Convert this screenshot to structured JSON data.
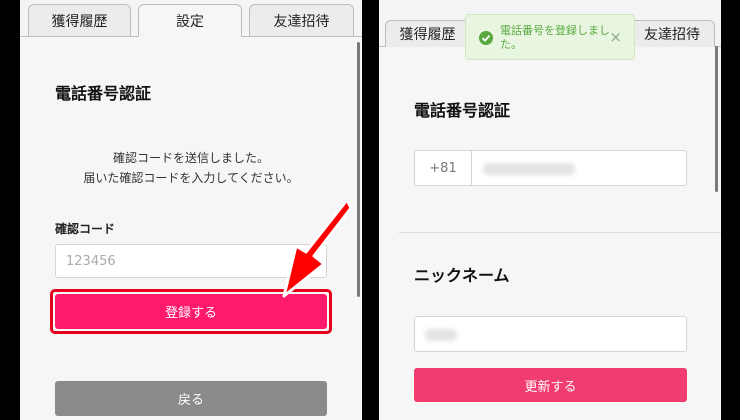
{
  "left_panel": {
    "tabs": [
      {
        "label": "獲得履歴",
        "active": false
      },
      {
        "label": "設定",
        "active": true
      },
      {
        "label": "友達招待",
        "active": false
      }
    ],
    "title": "電話番号認証",
    "message_line1": "確認コードを送信しました。",
    "message_line2": "届いた確認コードを入力してください。",
    "code_label": "確認コード",
    "code_placeholder": "123456",
    "register_button": "登録する",
    "back_button": "戻る"
  },
  "right_panel": {
    "tabs": [
      {
        "label": "獲得履歴",
        "active": false
      },
      {
        "label": "友達招待",
        "active": false
      }
    ],
    "toast": {
      "text": "電話番号を登録しました。",
      "close": "×"
    },
    "phone_title": "電話番号認証",
    "country_code": "+81",
    "nickname_title": "ニックネーム",
    "update_button": "更新する"
  },
  "colors": {
    "primary_pink": "#ff1a6b",
    "update_pink": "#f03c6e",
    "back_gray": "#8a8a8a",
    "highlight_red": "#e3001b",
    "toast_green": "#5aa93e"
  },
  "icons": {
    "toast": "check-circle-icon",
    "annotation": "red-arrow-icon",
    "back": "chevron-left-icon"
  }
}
